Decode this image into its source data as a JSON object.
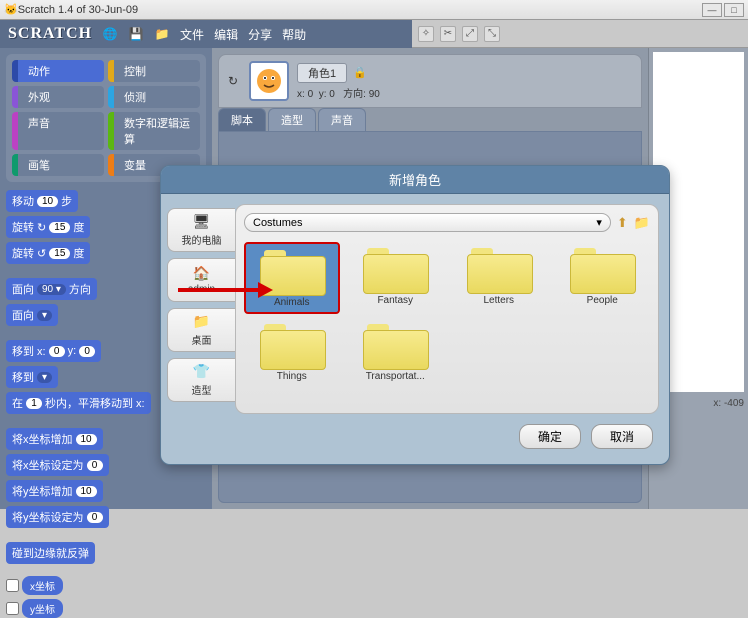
{
  "window": {
    "title": "Scratch 1.4 of 30-Jun-09"
  },
  "logo": "SCRATCH",
  "menu": {
    "file": "文件",
    "edit": "编辑",
    "share": "分享",
    "help": "帮助"
  },
  "categories": {
    "motion": "动作",
    "control": "控制",
    "looks": "外观",
    "sensing": "侦测",
    "sound": "声音",
    "operators": "数字和逻辑运算",
    "pen": "画笔",
    "variables": "变量"
  },
  "blocks": {
    "move_label": "移动",
    "move_val": "10",
    "move_steps": "步",
    "turn_cw": "旋转 ↻",
    "turn_cw_val": "15",
    "deg": "度",
    "turn_ccw": "旋转 ↺",
    "turn_ccw_val": "15",
    "point_dir": "面向",
    "point_dir_val": "90 ▾",
    "point_dir_suffix": "方向",
    "point_towards": "面向",
    "point_towards_val": " ▾",
    "goto_xy": "移到 x:",
    "goto_x": "0",
    "goto_y_label": "y:",
    "goto_y": "0",
    "goto_obj": "移到",
    "goto_obj_val": " ▾",
    "glide": "在",
    "glide_sec": "1",
    "glide_mid": "秒内，平滑移动到 x:",
    "change_x": "将x坐标增加",
    "change_x_val": "10",
    "set_x": "将x坐标设定为",
    "set_x_val": "0",
    "change_y": "将y坐标增加",
    "change_y_val": "10",
    "set_y": "将y坐标设定为",
    "set_y_val": "0",
    "bounce": "碰到边缘就反弹",
    "xpos": "x坐标",
    "ypos": "y坐标"
  },
  "sprite": {
    "name": "角色1",
    "xlabel": "x:",
    "x": "0",
    "ylabel": "y:",
    "0": "0",
    "dir_label": "方向:",
    "dir": "90"
  },
  "tabs": {
    "scripts": "脚本",
    "costumes": "造型",
    "sounds": "声音"
  },
  "stage": {
    "coords": "x: -409"
  },
  "dialog": {
    "title": "新增角色",
    "side": {
      "computer": "我的电脑",
      "admin": "admin",
      "desktop": "桌面",
      "costumes": "造型"
    },
    "path": "Costumes",
    "folders": [
      "Animals",
      "Fantasy",
      "Letters",
      "People",
      "Things",
      "Transportat..."
    ],
    "ok": "确定",
    "cancel": "取消"
  }
}
